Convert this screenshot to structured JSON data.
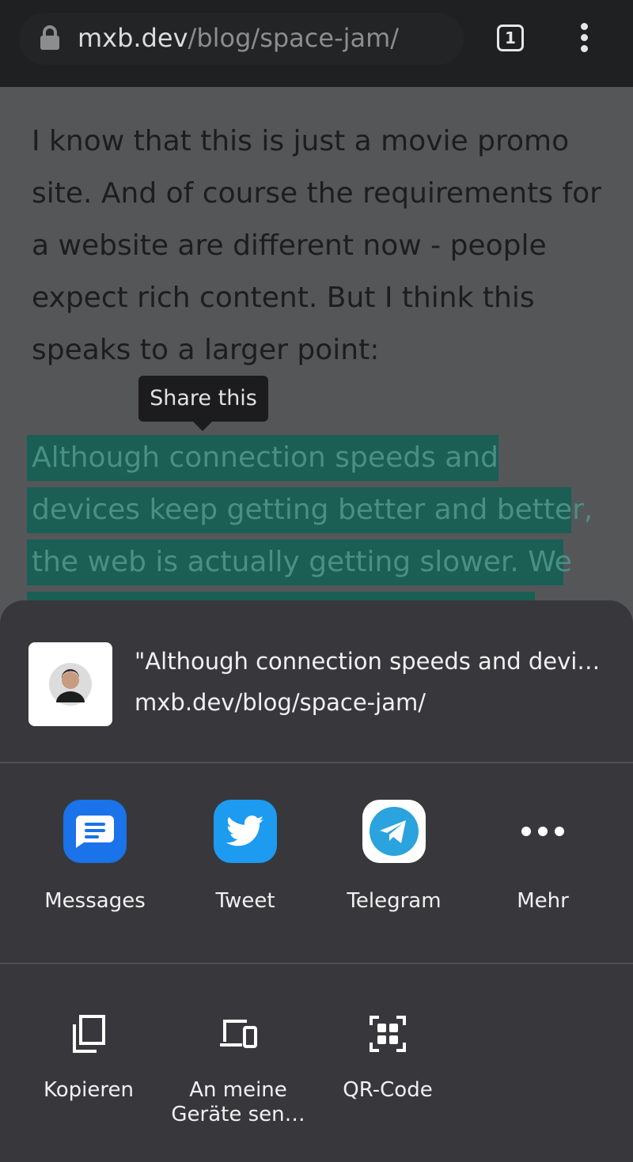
{
  "browser": {
    "url_host": "mxb.dev",
    "url_path": "/blog/space-jam/",
    "tab_count": "1",
    "icons": [
      "lock-icon",
      "tab-switcher-icon",
      "more-vert-icon"
    ]
  },
  "article": {
    "paragraph_lines": [
      "I know that this is just a movie promo",
      "site. And of course the requirements for",
      "a website are different now - people",
      "expect rich content. But I think this",
      "speaks to a larger point:"
    ],
    "highlight_lines": [
      "Although connection speeds and",
      "devices keep getting better and better,",
      "the web is actually getting slower. We"
    ],
    "highlight_color": "#1a5e54"
  },
  "tooltip": {
    "label": "Share this"
  },
  "share_sheet": {
    "preview_title": "\"Although connection speeds and devi…",
    "preview_url": "mxb.dev/blog/space-jam/",
    "apps": [
      {
        "label": "Messages",
        "icon": "messages-icon",
        "color": "#1a73e8"
      },
      {
        "label": "Tweet",
        "icon": "twitter-icon",
        "color": "#1d9bf0"
      },
      {
        "label": "Telegram",
        "icon": "telegram-icon",
        "color": "#2aa3de"
      },
      {
        "label": "Mehr",
        "icon": "more-horiz-icon"
      }
    ],
    "actions": [
      {
        "label": "Kopieren",
        "icon": "copy-icon"
      },
      {
        "label": "An meine\nGeräte sen…",
        "icon": "send-to-devices-icon"
      },
      {
        "label": "QR-Code",
        "icon": "qr-code-icon"
      }
    ]
  }
}
